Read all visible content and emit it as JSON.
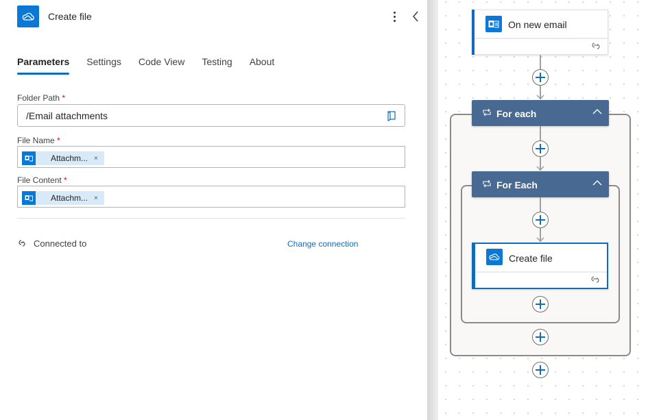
{
  "panel": {
    "title": "Create file",
    "header_icon": "onedrive-cloud-icon",
    "more_icon": "more-vertical-icon",
    "collapse_icon": "chevron-left-icon",
    "tabs": [
      {
        "label": "Parameters",
        "active": true
      },
      {
        "label": "Settings",
        "active": false
      },
      {
        "label": "Code View",
        "active": false
      },
      {
        "label": "Testing",
        "active": false
      },
      {
        "label": "About",
        "active": false
      }
    ],
    "fields": {
      "folder_path": {
        "label": "Folder Path",
        "required_mark": "*",
        "value": "/Email attachments",
        "icon": "folder-picker-icon"
      },
      "file_name": {
        "label": "File Name",
        "required_mark": "*",
        "token": {
          "label": "Attachm...",
          "icon": "outlook-icon",
          "remove": "×"
        }
      },
      "file_content": {
        "label": "File Content",
        "required_mark": "*",
        "token": {
          "label": "Attachm...",
          "icon": "outlook-icon",
          "remove": "×"
        }
      }
    },
    "connection": {
      "label": "Connected to",
      "change_label": "Change connection",
      "icon": "link-icon"
    }
  },
  "canvas": {
    "trigger": {
      "title": "On new email",
      "icon": "outlook-icon"
    },
    "outer_loop": {
      "title": "For each",
      "icon": "loop-icon"
    },
    "inner_loop": {
      "title": "For Each",
      "icon": "loop-icon"
    },
    "action": {
      "title": "Create file",
      "icon": "onedrive-cloud-icon",
      "selected": true
    }
  },
  "colors": {
    "accent": "#0f6cbd",
    "icon_bg": "#0a78d4",
    "loop_header": "#486991",
    "required": "#c50f1f",
    "token_bg": "#d8e9f7"
  }
}
